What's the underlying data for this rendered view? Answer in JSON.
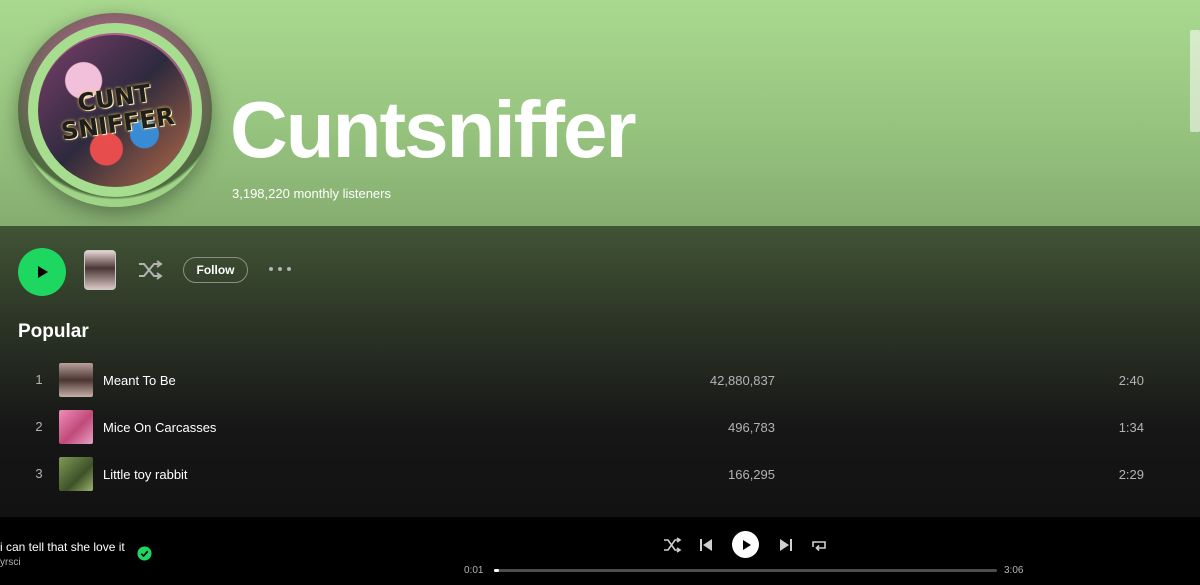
{
  "artist": {
    "name": "Cuntsniffer",
    "monthly_listeners": "3,198,220 monthly listeners",
    "avatar_logo_text": "CUNT SNIFFER"
  },
  "actions": {
    "follow_label": "Follow",
    "icons": [
      "play-icon",
      "shuffle-icon",
      "more-icon"
    ]
  },
  "popular": {
    "title": "Popular",
    "tracks": [
      {
        "number": "1",
        "title": "Meant To Be",
        "plays": "42,880,837",
        "duration": "2:40",
        "cover_color": "#6b4d4a"
      },
      {
        "number": "2",
        "title": "Mice On Carcasses",
        "plays": "496,783",
        "duration": "1:34",
        "cover_color": "#d86a9a"
      },
      {
        "number": "3",
        "title": "Little toy rabbit",
        "plays": "166,295",
        "duration": "2:29",
        "cover_color": "#5f7a3e"
      }
    ]
  },
  "player": {
    "now_title": "i can tell that she love it",
    "now_artist": "yrsci",
    "current_time": "0:01",
    "total_time": "3:06",
    "progress_fraction": 0.005,
    "accent": "#1ed760"
  }
}
